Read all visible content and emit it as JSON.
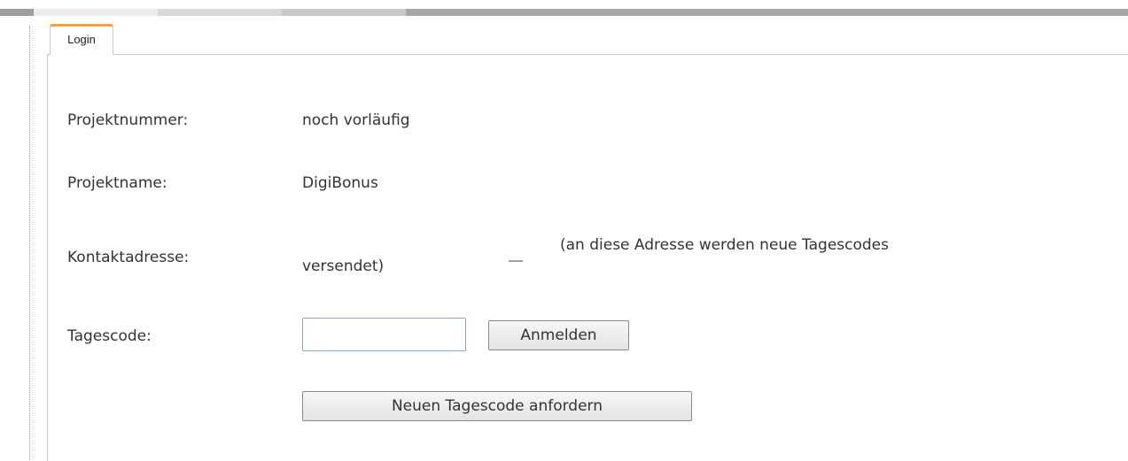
{
  "tabs": [
    {
      "label": "Login",
      "active": true
    }
  ],
  "accent_color": "#f0a43c",
  "form": {
    "project_number": {
      "label": "Projektnummer:",
      "value": "noch vorläufig"
    },
    "project_name": {
      "label": "Projektname:",
      "value": "DigiBonus"
    },
    "contact": {
      "label": "Kontaktadresse:",
      "note_line1": "(an diese Adresse werden neue Tagescodes",
      "note_line2": "versendet)"
    },
    "day_code": {
      "label": "Tagescode:",
      "value": "",
      "placeholder": ""
    }
  },
  "buttons": {
    "login_label": "Anmelden",
    "request_label": "Neuen Tagescode anfordern"
  }
}
